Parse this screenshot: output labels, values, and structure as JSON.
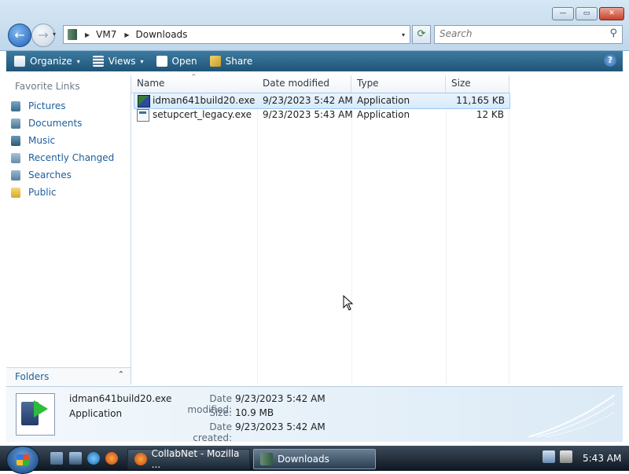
{
  "window": {
    "controls": {
      "minimize": "—",
      "maximize": "▭",
      "close": "✕"
    }
  },
  "nav": {
    "back_glyph": "←",
    "forward_glyph": "→",
    "history_glyph": "▾"
  },
  "address": {
    "segments": [
      "VM7",
      "Downloads"
    ],
    "separator": "▶",
    "dropdown_glyph": "▾",
    "refresh_glyph": "⟳"
  },
  "search": {
    "placeholder": "Search",
    "icon": "search-icon",
    "glyph": "⚲"
  },
  "toolbar": {
    "organize": "Organize",
    "views": "Views",
    "open": "Open",
    "share": "Share",
    "caret": "▾",
    "help": "?"
  },
  "left_nav": {
    "heading": "Favorite Links",
    "links": [
      "Pictures",
      "Documents",
      "Music",
      "Recently Changed",
      "Searches",
      "Public"
    ],
    "folders_label": "Folders",
    "folders_chevron": "⌃"
  },
  "file_list": {
    "columns": {
      "name": "Name",
      "date_modified": "Date modified",
      "type": "Type",
      "size": "Size"
    },
    "sort_glyph": "^",
    "rows": [
      {
        "name": "idman641build20.exe",
        "date_modified": "9/23/2023 5:42 AM",
        "type": "Application",
        "size": "11,165 KB",
        "selected": true
      },
      {
        "name": "setupcert_legacy.exe",
        "date_modified": "9/23/2023 5:43 AM",
        "type": "Application",
        "size": "12 KB",
        "selected": false
      }
    ]
  },
  "details": {
    "name": "idman641build20.exe",
    "type": "Application",
    "date_modified_label": "Date modified:",
    "date_modified": "9/23/2023 5:42 AM",
    "size_label": "Size:",
    "size": "10.9 MB",
    "date_created_label": "Date created:",
    "date_created": "9/23/2023 5:42 AM"
  },
  "taskbar": {
    "tasks": [
      "CollabNet - Mozilla ...",
      "Downloads"
    ],
    "clock": "5:43 AM"
  },
  "colors": {
    "link": "#1d5e9c",
    "command_bar": "#2a6389",
    "selection": "#d6eafb"
  }
}
